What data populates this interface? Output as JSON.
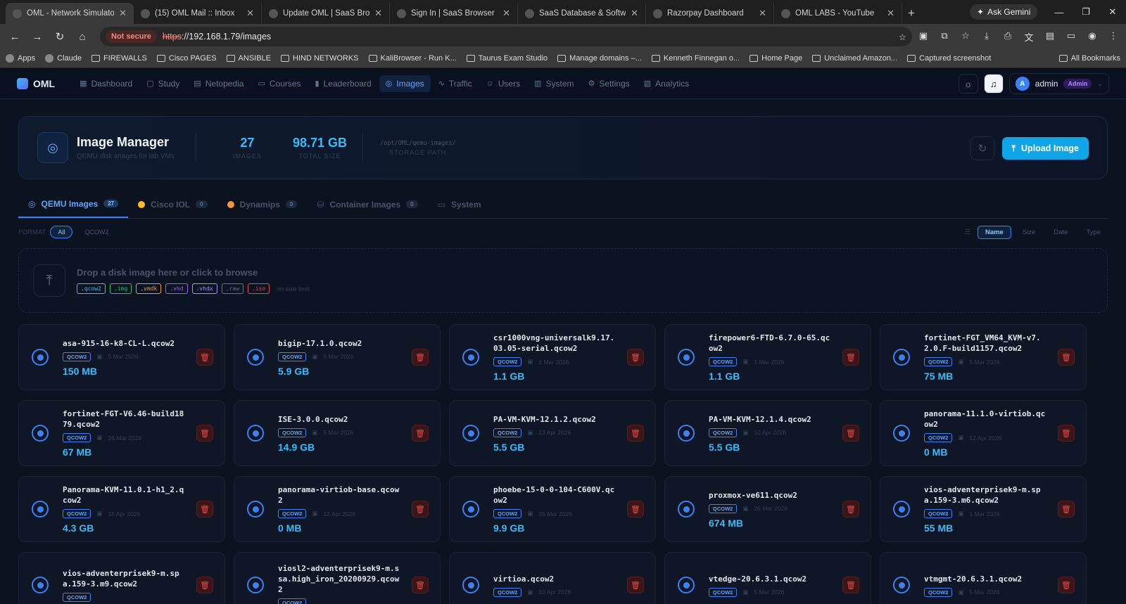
{
  "browser": {
    "tabs": [
      {
        "title": "OML - Network Simulator",
        "active": true
      },
      {
        "title": "(15) OML Mail :: Inbox"
      },
      {
        "title": "Update OML | SaaS Browser"
      },
      {
        "title": "Sign In | SaaS Browser"
      },
      {
        "title": "SaaS Database & Software S"
      },
      {
        "title": "Razorpay Dashboard"
      },
      {
        "title": "OML LABS - YouTube"
      }
    ],
    "gemini_label": "Ask Gemini",
    "not_secure": "Not secure",
    "url_scheme": "https",
    "url_rest": "://192.168.1.79/images",
    "bookmarks": [
      "Apps",
      "Claude",
      "FIREWALLS",
      "Cisco PAGES",
      "ANSIBLE",
      "HIND NETWORKS",
      "KaliBrowser - Run K...",
      "Taurus Exam Studio",
      "Manage domains –...",
      "Kenneth Finnegan o...",
      "Home Page",
      "Unclaimed Amazon...",
      "Captured screenshot"
    ],
    "all_bookmarks": "All Bookmarks"
  },
  "app": {
    "logo": "OML",
    "nav": [
      {
        "label": "Dashboard",
        "icon": "▦"
      },
      {
        "label": "Study",
        "icon": "▢"
      },
      {
        "label": "Netopedia",
        "icon": "▤"
      },
      {
        "label": "Courses",
        "icon": "▭"
      },
      {
        "label": "Leaderboard",
        "icon": "▮"
      },
      {
        "label": "Images",
        "icon": "◎",
        "active": true
      },
      {
        "label": "Traffic",
        "icon": "∿"
      },
      {
        "label": "Users",
        "icon": "☺"
      },
      {
        "label": "System",
        "icon": "▥"
      },
      {
        "label": "Settings",
        "icon": "⚙"
      },
      {
        "label": "Analytics",
        "icon": "▨"
      }
    ],
    "user": {
      "initial": "A",
      "name": "admin",
      "role": "Admin"
    }
  },
  "header": {
    "title": "Image Manager",
    "subtitle": "QEMU disk images for lab VMs",
    "images_count": "27",
    "images_label": "IMAGES",
    "total_size": "98.71 GB",
    "total_size_label": "TOTAL SIZE",
    "storage_path": "/opt/OML/qemu-images/",
    "storage_label": "STORAGE PATH",
    "upload_label": "Upload Image"
  },
  "image_tabs": [
    {
      "label": "QEMU Images",
      "count": "27",
      "active": true,
      "dot": null
    },
    {
      "label": "Cisco IOL",
      "count": "0",
      "dot": "#fbbf24"
    },
    {
      "label": "Dynamips",
      "count": "0",
      "dot": "#fb923c"
    },
    {
      "label": "Container Images",
      "count": "0",
      "dot": null
    },
    {
      "label": "System",
      "count": null,
      "dot": null
    }
  ],
  "filters": {
    "format_label": "FORMAT",
    "formats": [
      {
        "label": "All",
        "on": true
      },
      {
        "label": "QCOW2"
      }
    ],
    "sort_options": [
      {
        "label": "Name",
        "on": true
      },
      {
        "label": "Size"
      },
      {
        "label": "Date"
      },
      {
        "label": "Type"
      }
    ]
  },
  "dropzone": {
    "text": "Drop a disk image here or click to browse",
    "extensions": [
      {
        "ext": ".qcow2",
        "color": "#38bdf8"
      },
      {
        "ext": ".img",
        "color": "#22c55e"
      },
      {
        "ext": ".vmdk",
        "color": "#f59e0b"
      },
      {
        "ext": ".vhd",
        "color": "#a855f7"
      },
      {
        "ext": ".vhdx",
        "color": "#a78bfa"
      },
      {
        "ext": ".raw",
        "color": "#64748b"
      },
      {
        "ext": ".iso",
        "color": "#ef4444"
      }
    ],
    "limit": "no size limit"
  },
  "images": [
    {
      "name": "asa-915-16-k8-CL-L.qcow2",
      "fmt": "QCOW2",
      "date": "5 Mar 2026",
      "size": "150 MB"
    },
    {
      "name": "bigip-17.1.0.qcow2",
      "fmt": "QCOW2",
      "date": "5 Mar 2026",
      "size": "5.9 GB"
    },
    {
      "name": "csr1000vng-universalk9.17.03.05-serial.qcow2",
      "fmt": "QCOW2",
      "date": "1 Mar 2026",
      "size": "1.1 GB"
    },
    {
      "name": "firepower6-FTD-6.7.0-65.qcow2",
      "fmt": "QCOW2",
      "date": "1 Mar 2026",
      "size": "1.1 GB"
    },
    {
      "name": "fortinet-FGT_VM64_KVM-v7.2.0.F-build1157.qcow2",
      "fmt": "QCOW2",
      "date": "5 Mar 2026",
      "size": "75 MB"
    },
    {
      "name": "fortinet-FGT-V6.46-build1879.qcow2",
      "fmt": "QCOW2",
      "date": "26 Mar 2026",
      "size": "67 MB"
    },
    {
      "name": "ISE-3.0.0.qcow2",
      "fmt": "QCOW2",
      "date": "5 Mar 2026",
      "size": "14.9 GB"
    },
    {
      "name": "PA-VM-KVM-12.1.2.qcow2",
      "fmt": "QCOW2",
      "date": "13 Apr 2026",
      "size": "5.5 GB"
    },
    {
      "name": "PA-VM-KVM-12.1.4.qcow2",
      "fmt": "QCOW2",
      "date": "10 Apr 2026",
      "size": "5.5 GB"
    },
    {
      "name": "panorama-11.1.0-virtiob.qcow2",
      "fmt": "QCOW2",
      "date": "12 Apr 2026",
      "size": "0 MB"
    },
    {
      "name": "Panorama-KVM-11.0.1-h1_2.qcow2",
      "fmt": "QCOW2",
      "date": "15 Apr 2026",
      "size": "4.3 GB"
    },
    {
      "name": "panorama-virtiob-base.qcow2",
      "fmt": "QCOW2",
      "date": "12 Apr 2026",
      "size": "0 MB"
    },
    {
      "name": "phoebe-15-0-0-104-C600V.qcow2",
      "fmt": "QCOW2",
      "date": "26 Mar 2026",
      "size": "9.9 GB"
    },
    {
      "name": "proxmox-ve611.qcow2",
      "fmt": "QCOW2",
      "date": "26 Mar 2026",
      "size": "674 MB"
    },
    {
      "name": "vios-adventerprisek9-m.spa.159-3.m6.qcow2",
      "fmt": "QCOW2",
      "date": "1 Mar 2026",
      "size": "55 MB"
    },
    {
      "name": "vios-adventerprisek9-m.spa.159-3.m9.qcow2",
      "fmt": "QCOW2",
      "date": "",
      "size": ""
    },
    {
      "name": "viosl2-adventerprisek9-m.ssa.high_iron_20200929.qcow2",
      "fmt": "QCOW2",
      "date": "",
      "size": ""
    },
    {
      "name": "virtioa.qcow2",
      "fmt": "QCOW2",
      "date": "10 Apr 2026",
      "size": ""
    },
    {
      "name": "vtedge-20.6.3.1.qcow2",
      "fmt": "QCOW2",
      "date": "5 Mar 2026",
      "size": ""
    },
    {
      "name": "vtmgmt-20.6.3.1.qcow2",
      "fmt": "QCOW2",
      "date": "5 Mar 2026",
      "size": ""
    }
  ]
}
